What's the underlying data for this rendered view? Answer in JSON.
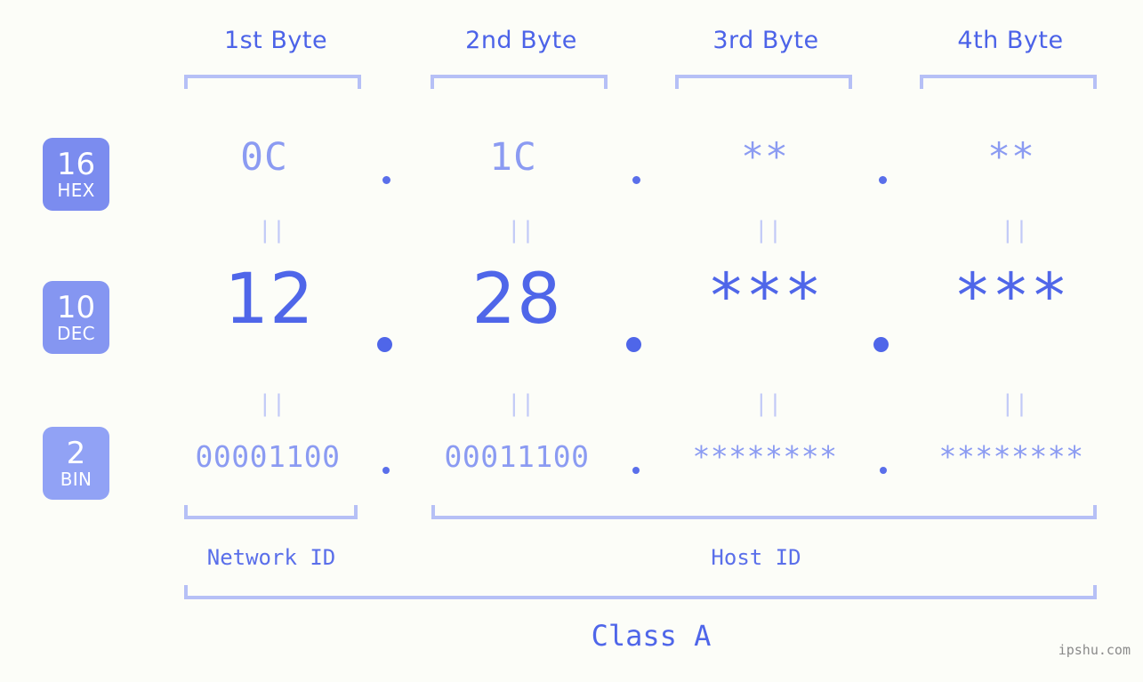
{
  "background_color": "#fcfdf8",
  "accent_color": "#4f66e9",
  "muted_accent_color": "#8b9bf2",
  "bracket_color": "#b6c0f6",
  "byte_headers": [
    {
      "label": "1st Byte"
    },
    {
      "label": "2nd Byte"
    },
    {
      "label": "3rd Byte"
    },
    {
      "label": "4th Byte"
    }
  ],
  "bases": [
    {
      "num": "16",
      "abbr": "HEX",
      "color": "#7b8cef"
    },
    {
      "num": "10",
      "abbr": "DEC",
      "color": "#8596f1"
    },
    {
      "num": "2",
      "abbr": "BIN",
      "color": "#91a2f5"
    }
  ],
  "rows": {
    "hex": {
      "values": [
        "0C",
        "1C",
        "**",
        "**"
      ]
    },
    "dec": {
      "values": [
        "12",
        "28",
        "***",
        "***"
      ]
    },
    "bin": {
      "values": [
        "00001100",
        "00011100",
        "********",
        "********"
      ]
    }
  },
  "separators": {
    "dot": ".",
    "equals": "||"
  },
  "segments": {
    "network_id": "Network ID",
    "host_id": "Host ID",
    "class": "Class A"
  },
  "watermark": "ipshu.com"
}
